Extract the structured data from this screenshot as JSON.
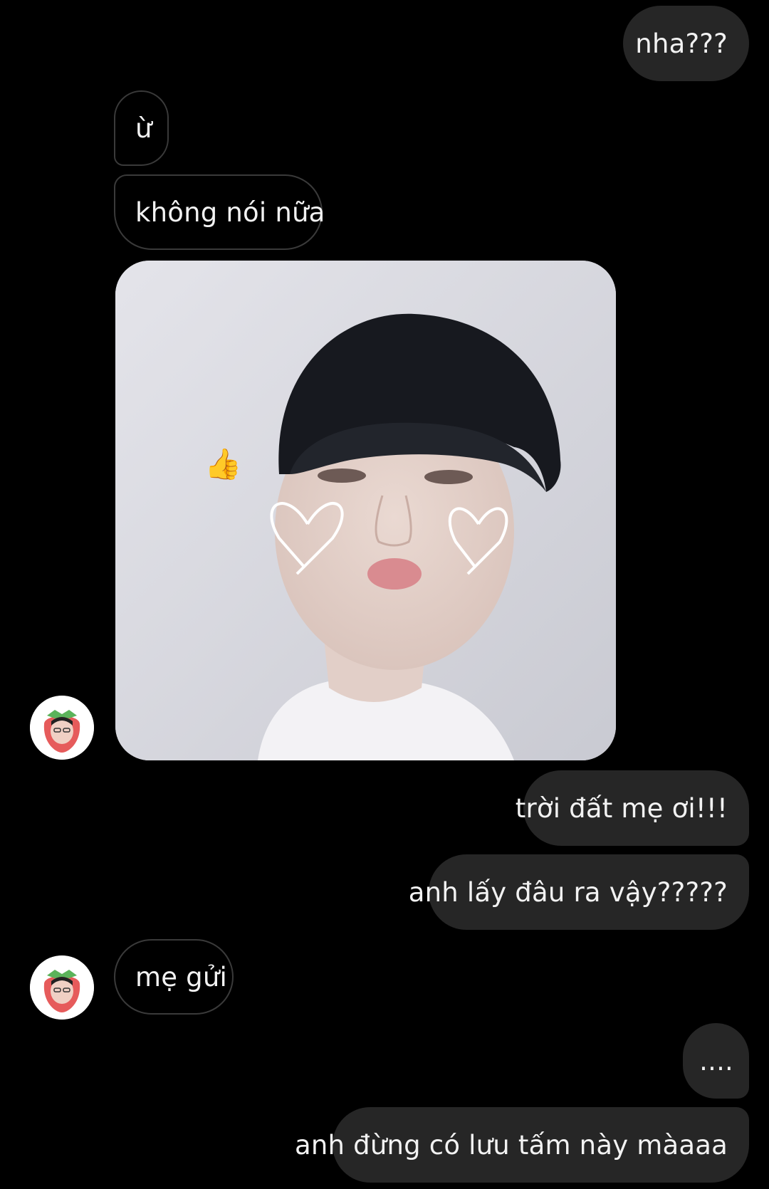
{
  "messages": {
    "m1": "nha???",
    "m2": "ừ",
    "m3": "không nói nữa",
    "m4": "trời đất mẹ ơi!!!",
    "m5": "anh lấy đâu ra vậy?????",
    "m6": "mẹ gửi",
    "m7": "....",
    "m8": "anh đừng có lưu tấm này màaaa"
  },
  "photo": {
    "subject": "photo of a boy with dark bowl-cut hair, drawn hearts on cheeks, and a thumbs-up emoji sticker",
    "sticker_emoji": "👍"
  },
  "icons": {
    "avatar": "strawberry-avatar-icon"
  },
  "colors": {
    "background": "#000000",
    "outgoing_bubble": "#262626",
    "incoming_border": "#3a3a3a",
    "text": "#f2f2f2"
  }
}
